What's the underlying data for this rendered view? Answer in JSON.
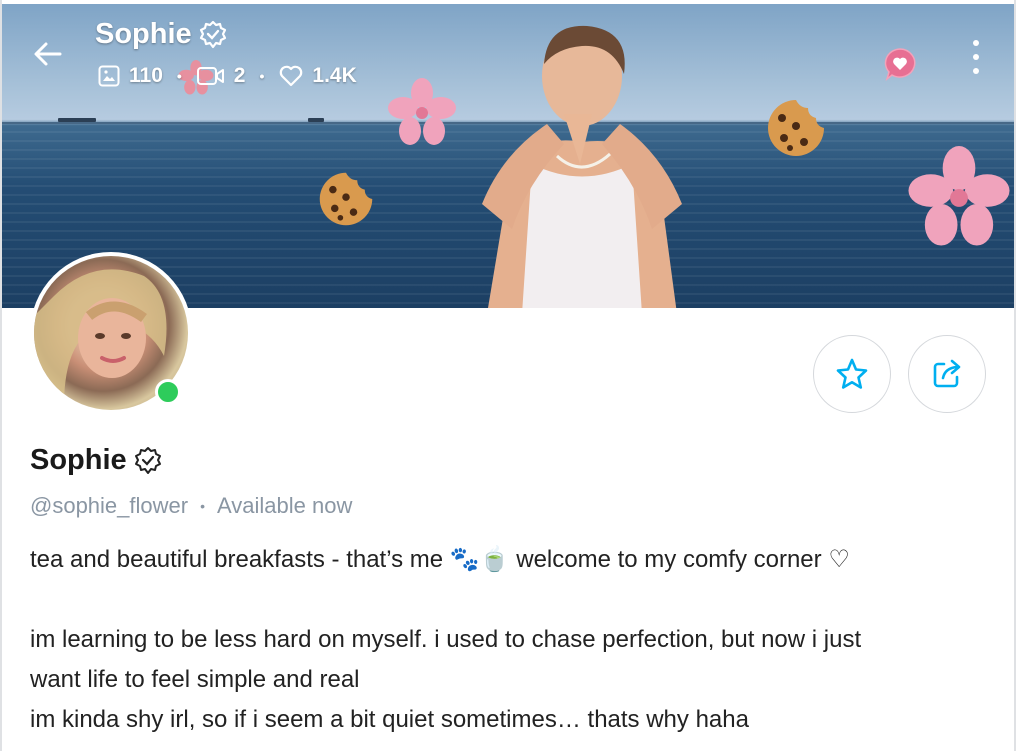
{
  "header": {
    "title": "Sophie",
    "stats": {
      "photos": "110",
      "videos": "2",
      "likes": "1.4K"
    },
    "icons": {
      "back": "arrow-left-icon",
      "verified": "verified-badge-icon",
      "photos": "image-icon",
      "videos": "video-icon",
      "likes": "heart-outline-icon",
      "tip": "heart-bubble-icon",
      "menu": "more-vertical-icon"
    }
  },
  "profile": {
    "name": "Sophie",
    "handle": "@sophie_flower",
    "status": "Available now",
    "online": true,
    "actions": {
      "favorite_icon": "star-outline-icon",
      "share_icon": "share-icon"
    }
  },
  "bio": {
    "line1": "tea and beautiful breakfasts - that’s me 🐾🍵 welcome to my comfy corner ♡",
    "line2": "",
    "line3": "im learning to be less hard on myself. i used to chase perfection, but now i just",
    "line4": "want life to feel simple and real",
    "line5": "im kinda shy irl, so if i seem a bit quiet sometimes… thats why haha"
  },
  "colors": {
    "accent": "#00aff0",
    "online": "#2ecc5b",
    "muted": "#8a96a3",
    "flower": "#f0a3bc"
  }
}
